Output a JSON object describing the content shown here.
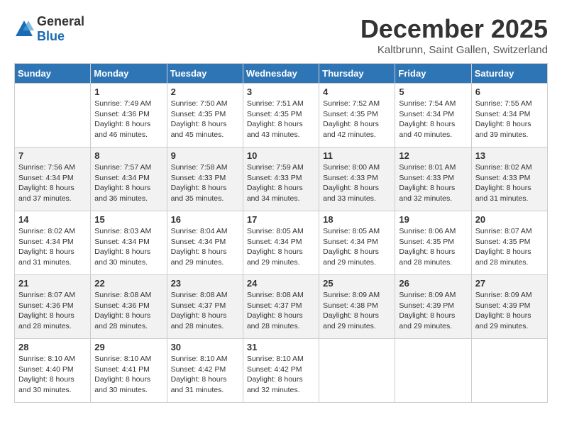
{
  "logo": {
    "general": "General",
    "blue": "Blue"
  },
  "header": {
    "title": "December 2025",
    "subtitle": "Kaltbrunn, Saint Gallen, Switzerland"
  },
  "columns": [
    "Sunday",
    "Monday",
    "Tuesday",
    "Wednesday",
    "Thursday",
    "Friday",
    "Saturday"
  ],
  "weeks": [
    [
      {
        "day": "",
        "sunrise": "",
        "sunset": "",
        "daylight": ""
      },
      {
        "day": "1",
        "sunrise": "Sunrise: 7:49 AM",
        "sunset": "Sunset: 4:36 PM",
        "daylight": "Daylight: 8 hours and 46 minutes."
      },
      {
        "day": "2",
        "sunrise": "Sunrise: 7:50 AM",
        "sunset": "Sunset: 4:35 PM",
        "daylight": "Daylight: 8 hours and 45 minutes."
      },
      {
        "day": "3",
        "sunrise": "Sunrise: 7:51 AM",
        "sunset": "Sunset: 4:35 PM",
        "daylight": "Daylight: 8 hours and 43 minutes."
      },
      {
        "day": "4",
        "sunrise": "Sunrise: 7:52 AM",
        "sunset": "Sunset: 4:35 PM",
        "daylight": "Daylight: 8 hours and 42 minutes."
      },
      {
        "day": "5",
        "sunrise": "Sunrise: 7:54 AM",
        "sunset": "Sunset: 4:34 PM",
        "daylight": "Daylight: 8 hours and 40 minutes."
      },
      {
        "day": "6",
        "sunrise": "Sunrise: 7:55 AM",
        "sunset": "Sunset: 4:34 PM",
        "daylight": "Daylight: 8 hours and 39 minutes."
      }
    ],
    [
      {
        "day": "7",
        "sunrise": "Sunrise: 7:56 AM",
        "sunset": "Sunset: 4:34 PM",
        "daylight": "Daylight: 8 hours and 37 minutes."
      },
      {
        "day": "8",
        "sunrise": "Sunrise: 7:57 AM",
        "sunset": "Sunset: 4:34 PM",
        "daylight": "Daylight: 8 hours and 36 minutes."
      },
      {
        "day": "9",
        "sunrise": "Sunrise: 7:58 AM",
        "sunset": "Sunset: 4:33 PM",
        "daylight": "Daylight: 8 hours and 35 minutes."
      },
      {
        "day": "10",
        "sunrise": "Sunrise: 7:59 AM",
        "sunset": "Sunset: 4:33 PM",
        "daylight": "Daylight: 8 hours and 34 minutes."
      },
      {
        "day": "11",
        "sunrise": "Sunrise: 8:00 AM",
        "sunset": "Sunset: 4:33 PM",
        "daylight": "Daylight: 8 hours and 33 minutes."
      },
      {
        "day": "12",
        "sunrise": "Sunrise: 8:01 AM",
        "sunset": "Sunset: 4:33 PM",
        "daylight": "Daylight: 8 hours and 32 minutes."
      },
      {
        "day": "13",
        "sunrise": "Sunrise: 8:02 AM",
        "sunset": "Sunset: 4:33 PM",
        "daylight": "Daylight: 8 hours and 31 minutes."
      }
    ],
    [
      {
        "day": "14",
        "sunrise": "Sunrise: 8:02 AM",
        "sunset": "Sunset: 4:34 PM",
        "daylight": "Daylight: 8 hours and 31 minutes."
      },
      {
        "day": "15",
        "sunrise": "Sunrise: 8:03 AM",
        "sunset": "Sunset: 4:34 PM",
        "daylight": "Daylight: 8 hours and 30 minutes."
      },
      {
        "day": "16",
        "sunrise": "Sunrise: 8:04 AM",
        "sunset": "Sunset: 4:34 PM",
        "daylight": "Daylight: 8 hours and 29 minutes."
      },
      {
        "day": "17",
        "sunrise": "Sunrise: 8:05 AM",
        "sunset": "Sunset: 4:34 PM",
        "daylight": "Daylight: 8 hours and 29 minutes."
      },
      {
        "day": "18",
        "sunrise": "Sunrise: 8:05 AM",
        "sunset": "Sunset: 4:34 PM",
        "daylight": "Daylight: 8 hours and 29 minutes."
      },
      {
        "day": "19",
        "sunrise": "Sunrise: 8:06 AM",
        "sunset": "Sunset: 4:35 PM",
        "daylight": "Daylight: 8 hours and 28 minutes."
      },
      {
        "day": "20",
        "sunrise": "Sunrise: 8:07 AM",
        "sunset": "Sunset: 4:35 PM",
        "daylight": "Daylight: 8 hours and 28 minutes."
      }
    ],
    [
      {
        "day": "21",
        "sunrise": "Sunrise: 8:07 AM",
        "sunset": "Sunset: 4:36 PM",
        "daylight": "Daylight: 8 hours and 28 minutes."
      },
      {
        "day": "22",
        "sunrise": "Sunrise: 8:08 AM",
        "sunset": "Sunset: 4:36 PM",
        "daylight": "Daylight: 8 hours and 28 minutes."
      },
      {
        "day": "23",
        "sunrise": "Sunrise: 8:08 AM",
        "sunset": "Sunset: 4:37 PM",
        "daylight": "Daylight: 8 hours and 28 minutes."
      },
      {
        "day": "24",
        "sunrise": "Sunrise: 8:08 AM",
        "sunset": "Sunset: 4:37 PM",
        "daylight": "Daylight: 8 hours and 28 minutes."
      },
      {
        "day": "25",
        "sunrise": "Sunrise: 8:09 AM",
        "sunset": "Sunset: 4:38 PM",
        "daylight": "Daylight: 8 hours and 29 minutes."
      },
      {
        "day": "26",
        "sunrise": "Sunrise: 8:09 AM",
        "sunset": "Sunset: 4:39 PM",
        "daylight": "Daylight: 8 hours and 29 minutes."
      },
      {
        "day": "27",
        "sunrise": "Sunrise: 8:09 AM",
        "sunset": "Sunset: 4:39 PM",
        "daylight": "Daylight: 8 hours and 29 minutes."
      }
    ],
    [
      {
        "day": "28",
        "sunrise": "Sunrise: 8:10 AM",
        "sunset": "Sunset: 4:40 PM",
        "daylight": "Daylight: 8 hours and 30 minutes."
      },
      {
        "day": "29",
        "sunrise": "Sunrise: 8:10 AM",
        "sunset": "Sunset: 4:41 PM",
        "daylight": "Daylight: 8 hours and 30 minutes."
      },
      {
        "day": "30",
        "sunrise": "Sunrise: 8:10 AM",
        "sunset": "Sunset: 4:42 PM",
        "daylight": "Daylight: 8 hours and 31 minutes."
      },
      {
        "day": "31",
        "sunrise": "Sunrise: 8:10 AM",
        "sunset": "Sunset: 4:42 PM",
        "daylight": "Daylight: 8 hours and 32 minutes."
      },
      {
        "day": "",
        "sunrise": "",
        "sunset": "",
        "daylight": ""
      },
      {
        "day": "",
        "sunrise": "",
        "sunset": "",
        "daylight": ""
      },
      {
        "day": "",
        "sunrise": "",
        "sunset": "",
        "daylight": ""
      }
    ]
  ]
}
